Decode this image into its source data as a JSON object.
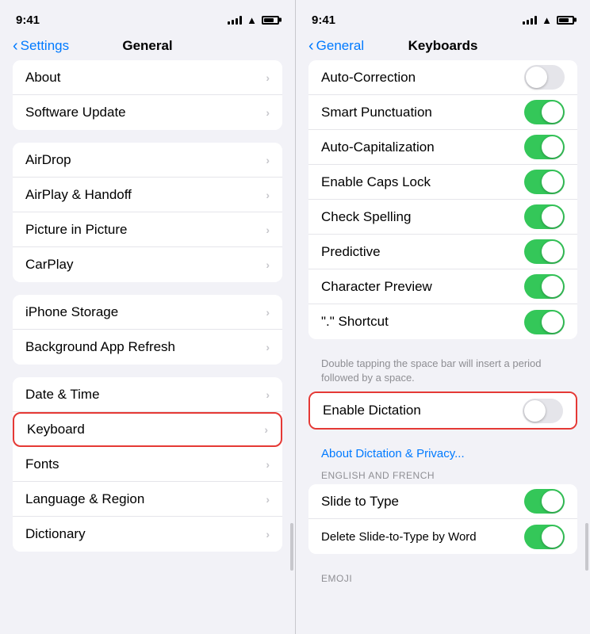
{
  "left_panel": {
    "status": {
      "time": "9:41"
    },
    "nav": {
      "back_label": "Settings",
      "title": "General"
    },
    "groups": [
      {
        "id": "group1",
        "rows": [
          {
            "id": "about",
            "label": "About",
            "chevron": true
          },
          {
            "id": "software-update",
            "label": "Software Update",
            "chevron": true
          }
        ]
      },
      {
        "id": "group2",
        "rows": [
          {
            "id": "airdrop",
            "label": "AirDrop",
            "chevron": true
          },
          {
            "id": "airplay-handoff",
            "label": "AirPlay & Handoff",
            "chevron": true
          },
          {
            "id": "picture-in-picture",
            "label": "Picture in Picture",
            "chevron": true
          },
          {
            "id": "carplay",
            "label": "CarPlay",
            "chevron": true
          }
        ]
      },
      {
        "id": "group3",
        "rows": [
          {
            "id": "iphone-storage",
            "label": "iPhone Storage",
            "chevron": true
          },
          {
            "id": "background-app-refresh",
            "label": "Background App Refresh",
            "chevron": true
          }
        ]
      },
      {
        "id": "group4",
        "rows": [
          {
            "id": "date-time",
            "label": "Date & Time",
            "chevron": true
          },
          {
            "id": "keyboard",
            "label": "Keyboard",
            "chevron": true,
            "highlighted": true
          },
          {
            "id": "fonts",
            "label": "Fonts",
            "chevron": true
          },
          {
            "id": "language-region",
            "label": "Language & Region",
            "chevron": true
          },
          {
            "id": "dictionary",
            "label": "Dictionary",
            "chevron": true
          }
        ]
      }
    ]
  },
  "right_panel": {
    "status": {
      "time": "9:41"
    },
    "nav": {
      "back_label": "General",
      "title": "Keyboards"
    },
    "rows": [
      {
        "id": "auto-correction",
        "label": "Auto-Correction",
        "toggle": true,
        "on": false
      },
      {
        "id": "smart-punctuation",
        "label": "Smart Punctuation",
        "toggle": true,
        "on": true
      },
      {
        "id": "auto-capitalization",
        "label": "Auto-Capitalization",
        "toggle": true,
        "on": true
      },
      {
        "id": "enable-caps-lock",
        "label": "Enable Caps Lock",
        "toggle": true,
        "on": true
      },
      {
        "id": "check-spelling",
        "label": "Check Spelling",
        "toggle": true,
        "on": true
      },
      {
        "id": "predictive",
        "label": "Predictive",
        "toggle": true,
        "on": true
      },
      {
        "id": "character-preview",
        "label": "Character Preview",
        "toggle": true,
        "on": true
      },
      {
        "id": "period-shortcut",
        "label": "\".\" Shortcut",
        "toggle": true,
        "on": true
      }
    ],
    "period_note": "Double tapping the space bar will insert a period followed by a space.",
    "enable_dictation": {
      "label": "Enable Dictation",
      "toggle": true,
      "on": false,
      "highlighted": true
    },
    "dictation_link": "About Dictation & Privacy...",
    "section_label": "ENGLISH AND FRENCH",
    "bottom_rows": [
      {
        "id": "slide-to-type",
        "label": "Slide to Type",
        "toggle": true,
        "on": true
      },
      {
        "id": "delete-slide",
        "label": "Delete Slide-to-Type by Word",
        "toggle": true,
        "on": true
      }
    ],
    "emoji_section": "EMOJI"
  },
  "icons": {
    "chevron": "›",
    "back_arrow": "‹",
    "wifi": "wifi"
  }
}
